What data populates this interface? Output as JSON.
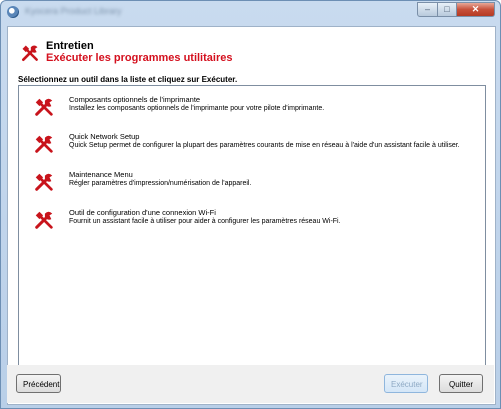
{
  "window": {
    "title": "Kyocera Product Library"
  },
  "header": {
    "title": "Entretien",
    "subtitle": "Exécuter les programmes utilitaires"
  },
  "instruction": "Sélectionnez un outil dans la liste et cliquez sur Exécuter.",
  "tools": [
    {
      "title": "Composants optionnels de l'imprimante",
      "description": "Installez les composants optionnels de l'imprimante pour votre pilote d'imprimante."
    },
    {
      "title": "Quick Network Setup",
      "description": "Quick Setup permet de configurer la plupart des paramètres courants de mise en réseau à l'aide d'un assistant facile à utiliser."
    },
    {
      "title": "Maintenance Menu",
      "description": "Régler paramètres d'impression/numérisation de l'appareil."
    },
    {
      "title": "Outil de configuration d'une connexion Wi-Fi",
      "description": "Fournit un assistant facile à utiliser pour aider à configurer les paramètres réseau Wi-Fi."
    }
  ],
  "buttons": {
    "previous": "Précédent",
    "execute": "Exécuter",
    "quit": "Quitter"
  },
  "icons": {
    "tool": "tools-icon"
  },
  "colors": {
    "accent_red": "#d4101e",
    "icon_red": "#c8141c",
    "disabled_text": "#8ea9c4"
  }
}
